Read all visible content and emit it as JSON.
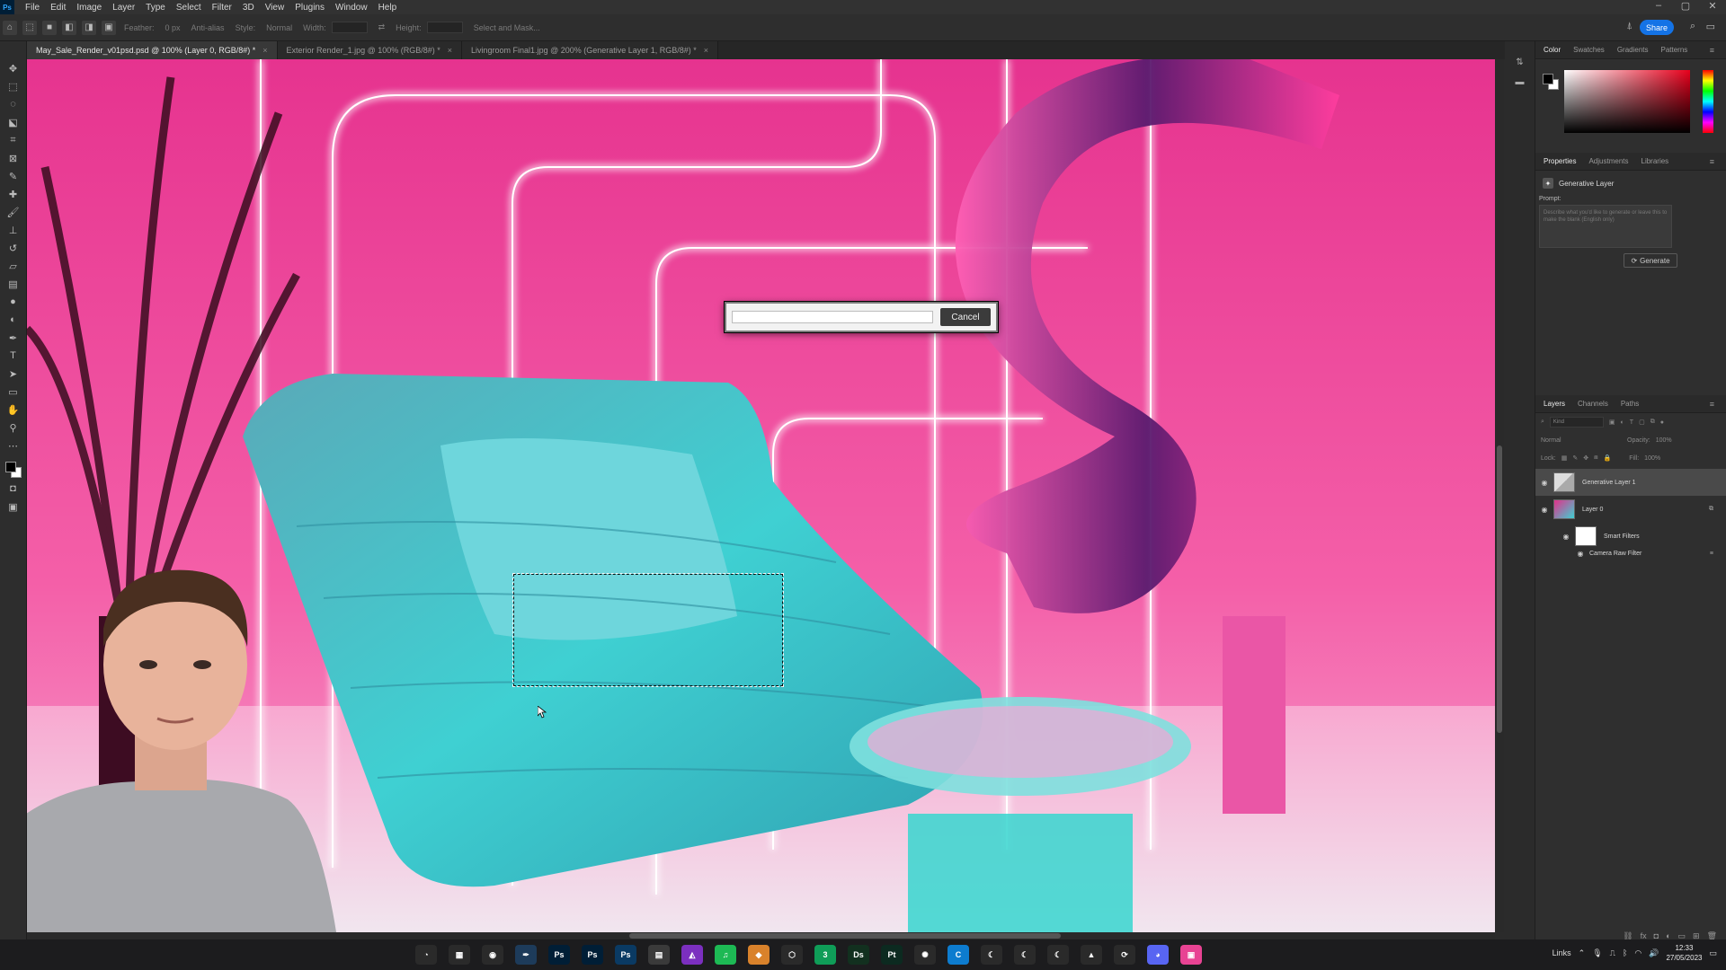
{
  "app": {
    "logo": "Ps",
    "menu": [
      "File",
      "Edit",
      "Image",
      "Layer",
      "Type",
      "Select",
      "Filter",
      "3D",
      "View",
      "Plugins",
      "Window",
      "Help"
    ],
    "window_controls": [
      "–",
      "▢",
      "✕"
    ]
  },
  "options_bar": {
    "feather_label": "Feather:",
    "feather_value": "0 px",
    "antialias_label": "Anti-alias",
    "style_label": "Style:",
    "style_value": "Normal",
    "width_label": "Width:",
    "height_label": "Height:",
    "select_mask_label": "Select and Mask...",
    "share_label": "Share"
  },
  "tabs": [
    {
      "label": "May_Sale_Render_v01psd.psd @ 100% (Layer 0, RGB/8#) *",
      "close": "×"
    },
    {
      "label": "Exterior Render_1.jpg @ 100% (RGB/8#) *",
      "close": "×"
    },
    {
      "label": "Livingroom Final1.jpg @ 200% (Generative Layer 1, RGB/8#) *",
      "close": "×"
    }
  ],
  "progress_dialog": {
    "cancel_label": "Cancel"
  },
  "color_panel": {
    "tabs": [
      "Color",
      "Swatches",
      "Gradients",
      "Patterns"
    ],
    "foreground": "#000000",
    "background": "#ffffff",
    "accent": "#e8001c"
  },
  "properties_panel": {
    "tabs": [
      "Properties",
      "Adjustments",
      "Libraries"
    ],
    "layer_type": "Generative Layer",
    "prompt_label": "Prompt:",
    "prompt_placeholder": "Describe what you'd like to generate or leave this to make the blank (English only)",
    "generate_label": "Generate"
  },
  "layers_panel": {
    "tabs": [
      "Layers",
      "Channels",
      "Paths"
    ],
    "kind_label": "Kind",
    "blend_mode": "Normal",
    "opacity_label": "Opacity:",
    "opacity_value": "100%",
    "lock_label": "Lock:",
    "fill_label": "Fill:",
    "fill_value": "100%",
    "layers": [
      {
        "name": "Generative Layer 1",
        "selected": true
      },
      {
        "name": "Layer 0",
        "selected": false
      },
      {
        "name": "Smart Filters",
        "selected": false
      },
      {
        "name": "Camera Raw Filter",
        "selected": false
      }
    ]
  },
  "taskbar": {
    "links_label": "Links",
    "time": "12:33",
    "date": "27/05/2023",
    "apps": [
      {
        "icon": "clock-icon",
        "glyph": "◔",
        "color": "#2a2a2a"
      },
      {
        "icon": "calculator-icon",
        "glyph": "▦",
        "color": "#2a2a2a"
      },
      {
        "icon": "chrome-icon",
        "glyph": "◉",
        "color": "#2a2a2a"
      },
      {
        "icon": "pen-icon",
        "glyph": "✒",
        "color": "#1d3b5a"
      },
      {
        "icon": "photoshop-icon",
        "glyph": "Ps",
        "color": "#001e36"
      },
      {
        "icon": "photoshop-beta-icon",
        "glyph": "Ps",
        "color": "#001e36"
      },
      {
        "icon": "photoshop-active-icon",
        "glyph": "Ps",
        "color": "#0a3a63"
      },
      {
        "icon": "files-icon",
        "glyph": "▤",
        "color": "#3a3a3a"
      },
      {
        "icon": "affinity-icon",
        "glyph": "◭",
        "color": "#7b2fbf"
      },
      {
        "icon": "spotify-icon",
        "glyph": "♫",
        "color": "#1db954"
      },
      {
        "icon": "box-icon",
        "glyph": "◆",
        "color": "#d9822b"
      },
      {
        "icon": "cube-icon",
        "glyph": "⬡",
        "color": "#2a2a2a"
      },
      {
        "icon": "sheets-icon",
        "glyph": "3",
        "color": "#0f9d58"
      },
      {
        "icon": "dimension-icon",
        "glyph": "Ds",
        "color": "#12301f"
      },
      {
        "icon": "painter-icon",
        "glyph": "Pt",
        "color": "#0c2a20"
      },
      {
        "icon": "blender-icon",
        "glyph": "✺",
        "color": "#2a2a2a"
      },
      {
        "icon": "cinema-icon",
        "glyph": "C",
        "color": "#0d7ccf"
      },
      {
        "icon": "rhino-icon",
        "glyph": "☾",
        "color": "#2a2a2a"
      },
      {
        "icon": "rhino2-icon",
        "glyph": "☾",
        "color": "#2a2a2a"
      },
      {
        "icon": "rhino3-icon",
        "glyph": "☾",
        "color": "#2a2a2a"
      },
      {
        "icon": "vlc-icon",
        "glyph": "▲",
        "color": "#2a2a2a"
      },
      {
        "icon": "sync-icon",
        "glyph": "⟳",
        "color": "#2a2a2a"
      },
      {
        "icon": "discord-icon",
        "glyph": "◕",
        "color": "#5865f2"
      },
      {
        "icon": "gallery-icon",
        "glyph": "▣",
        "color": "#e84393"
      }
    ]
  }
}
